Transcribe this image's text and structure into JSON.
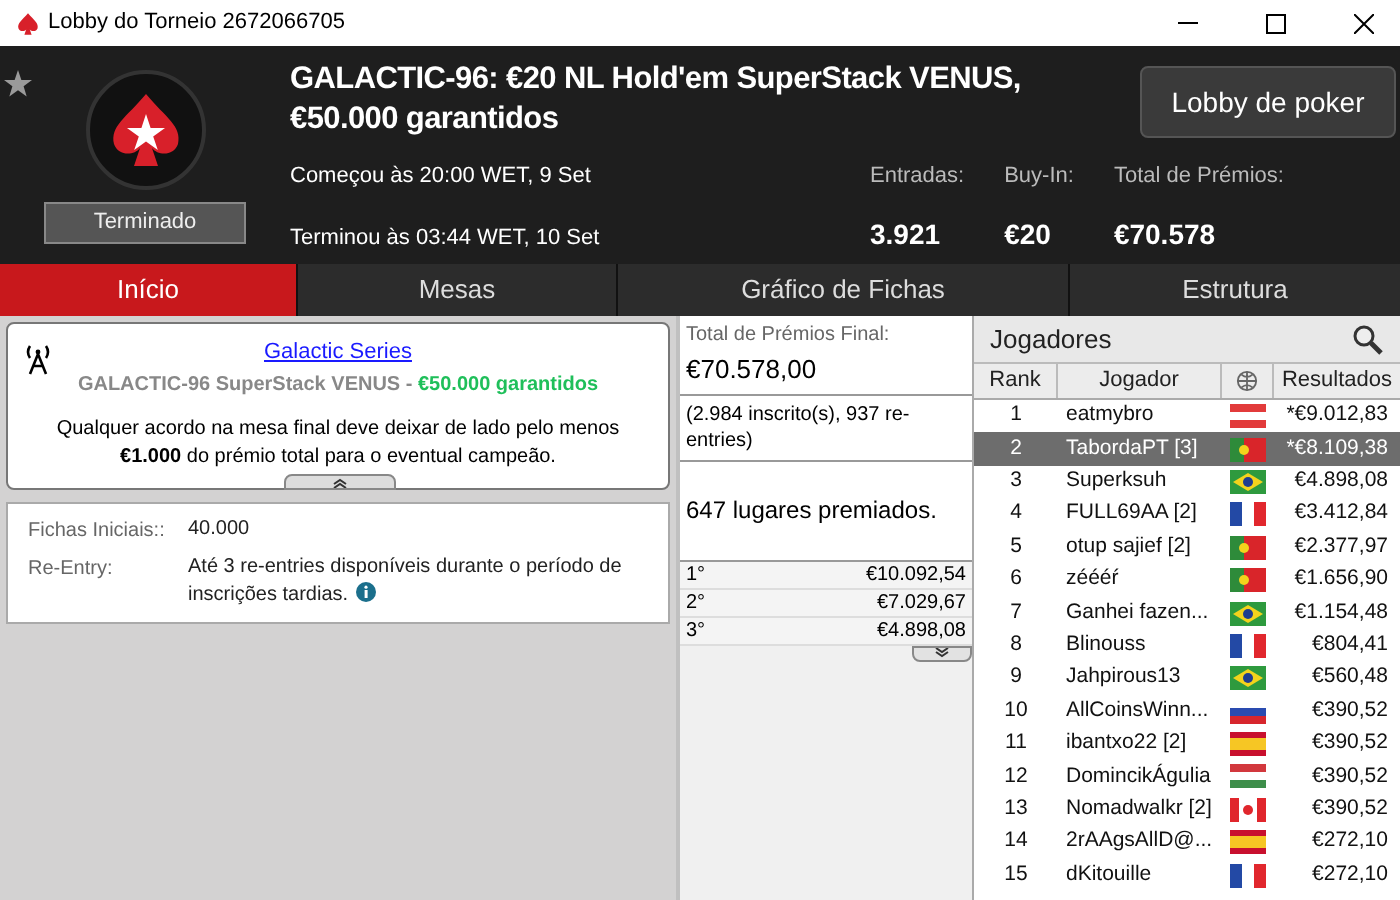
{
  "window": {
    "title": "Lobby do Torneio 2672066705"
  },
  "header": {
    "title": "GALACTIC-96: €20 NL Hold'em SuperStack VENUS, €50.000 garantidos",
    "status": "Terminado",
    "started": "Começou às 20:00 WET, 9 Set",
    "finished": "Terminou às 03:44 WET, 10 Set",
    "lobby_button": "Lobby de poker",
    "stats": [
      {
        "label": "Entradas:",
        "value": "3.921"
      },
      {
        "label": "Buy-In:",
        "value": "€20"
      },
      {
        "label": "Total de Prémios:",
        "value": "€70.578"
      }
    ]
  },
  "tabs": [
    {
      "label": "Início",
      "selected": true
    },
    {
      "label": "Mesas",
      "selected": false
    },
    {
      "label": "Gráfico de Fichas",
      "selected": false
    },
    {
      "label": "Estrutura",
      "selected": false
    }
  ],
  "info": {
    "link": "Galactic Series",
    "subtitle": "GALACTIC-96 SuperStack VENUS - ",
    "guarantee": "€50.000 garantidos",
    "notice": "Qualquer acordo na mesa final deve deixar de lado pelo menos **€1.000** do prémio total para o eventual campeão.",
    "details": [
      {
        "label": "Fichas Iniciais::",
        "value": "40.000",
        "info": false
      },
      {
        "label": "Re-Entry:",
        "value": "Até 3 re-entries disponíveis durante o período de inscrições tardias.",
        "info": true
      }
    ]
  },
  "prizes": {
    "label": "Total de Prémios Final:",
    "total": "€70.578,00",
    "entries": "(2.984 inscrito(s), 937 re-entries)",
    "paid": "647 lugares premiados.",
    "places": [
      {
        "place": "1°",
        "amount": "€10.092,54"
      },
      {
        "place": "2°",
        "amount": "€7.029,67"
      },
      {
        "place": "3°",
        "amount": "€4.898,08"
      }
    ]
  },
  "players": {
    "title": "Jogadores",
    "columns": [
      "Rank",
      "Jogador",
      "Resultados"
    ],
    "rows": [
      {
        "rank": "1",
        "name": "eatmybro",
        "kind": "austria",
        "result": "*€9.012,83",
        "selected": false
      },
      {
        "rank": "2",
        "name": "TabordaPT [3]",
        "kind": "portugal",
        "result": "*€8.109,38",
        "selected": true
      },
      {
        "rank": "3",
        "name": "Superksuh",
        "kind": "brazil",
        "result": "€4.898,08",
        "selected": false
      },
      {
        "rank": "4",
        "name": "FULL69AA [2]",
        "kind": "france",
        "result": "€3.412,84",
        "selected": false
      },
      {
        "rank": "5",
        "name": "otup sajief [2]",
        "kind": "portugal",
        "result": "€2.377,97",
        "selected": false
      },
      {
        "rank": "6",
        "name": "zéééŕ",
        "kind": "portugal",
        "result": "€1.656,90",
        "selected": false
      },
      {
        "rank": "7",
        "name": "Ganhei fazen...",
        "kind": "brazil",
        "result": "€1.154,48",
        "selected": false
      },
      {
        "rank": "8",
        "name": "Blinouss",
        "kind": "france",
        "result": "€804,41",
        "selected": false
      },
      {
        "rank": "9",
        "name": "Jahpirous13",
        "kind": "brazil",
        "result": "€560,48",
        "selected": false
      },
      {
        "rank": "10",
        "name": "AllCoinsWinn...",
        "kind": "russia",
        "result": "€390,52",
        "selected": false
      },
      {
        "rank": "11",
        "name": "ibantxo22 [2]",
        "kind": "spain",
        "result": "€390,52",
        "selected": false
      },
      {
        "rank": "12",
        "name": "DomincikÁgulia",
        "kind": "hungary",
        "result": "€390,52",
        "selected": false
      },
      {
        "rank": "13",
        "name": "Nomadwalkr [2]",
        "kind": "canada",
        "result": "€390,52",
        "selected": false
      },
      {
        "rank": "14",
        "name": "2rAAgsAllD@...",
        "kind": "spain",
        "result": "€272,10",
        "selected": false
      },
      {
        "rank": "15",
        "name": "dKitouille",
        "kind": "france",
        "result": "€272,10",
        "selected": false
      }
    ]
  }
}
